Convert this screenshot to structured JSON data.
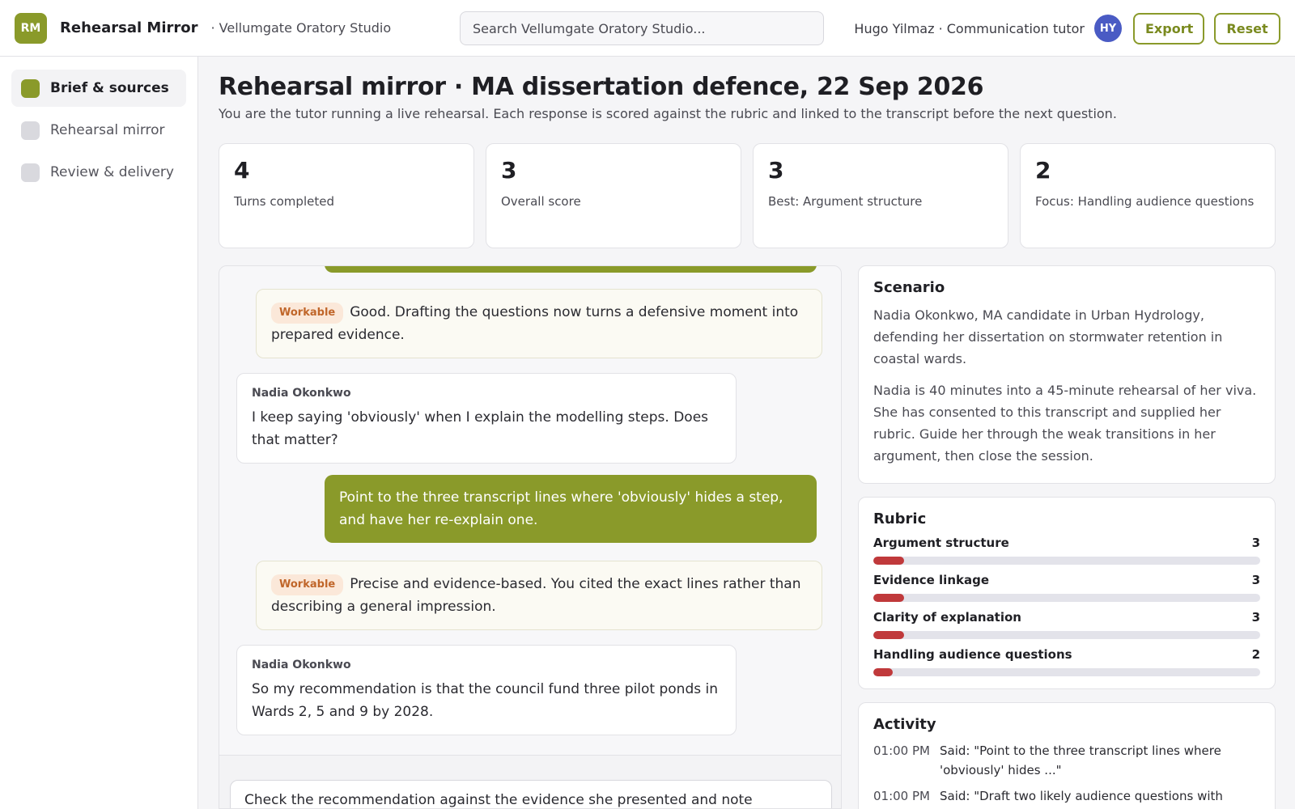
{
  "header": {
    "logo_text": "RM",
    "app_name": "Rehearsal Mirror",
    "org_name": "· Vellumgate Oratory Studio",
    "search_placeholder": "Search Vellumgate Oratory Studio...",
    "user_label": "Hugo Yilmaz · Communication tutor",
    "avatar_initials": "HY",
    "export_label": "Export",
    "reset_label": "Reset"
  },
  "sidebar": {
    "items": [
      {
        "label": "Brief & sources",
        "active": true
      },
      {
        "label": "Rehearsal mirror",
        "active": false
      },
      {
        "label": "Review & delivery",
        "active": false
      }
    ]
  },
  "page": {
    "title": "Rehearsal mirror · MA dissertation defence, 22 Sep 2026",
    "subtitle": "You are the tutor running a live rehearsal. Each response is scored against the rubric and linked to the transcript before the next question."
  },
  "stats": [
    {
      "value": "4",
      "label": "Turns completed"
    },
    {
      "value": "3",
      "label": "Overall score"
    },
    {
      "value": "3",
      "label": "Best: Argument structure"
    },
    {
      "value": "2",
      "label": "Focus: Handling audience questions"
    }
  ],
  "chat": {
    "messages": [
      {
        "badge": "Workable",
        "text": "Good. Drafting the questions now turns a defensive moment into prepared evidence."
      },
      {
        "speaker": "Nadia Okonkwo",
        "text": "I keep saying 'obviously' when I explain the modelling steps. Does that matter?"
      },
      {
        "text": "Point to the three transcript lines where 'obviously' hides a step, and have her re-explain one."
      },
      {
        "badge": "Workable",
        "text": "Precise and evidence-based. You cited the exact lines rather than describing a general impression."
      },
      {
        "speaker": "Nadia Okonkwo",
        "text": "So my recommendation is that the council fund three pilot ponds in Wards 2, 5 and 9 by 2028."
      }
    ],
    "composer_value": "Check the recommendation against the evidence she presented and note"
  },
  "scenario": {
    "title": "Scenario",
    "p1": "Nadia Okonkwo, MA candidate in Urban Hydrology, defending her dissertation on stormwater retention in coastal wards.",
    "p2": "Nadia is 40 minutes into a 45-minute rehearsal of her viva. She has consented to this transcript and supplied her rubric. Guide her through the weak transitions in her argument, then close the session."
  },
  "rubric": {
    "title": "Rubric",
    "max_score": 5,
    "items": [
      {
        "label": "Argument structure",
        "score": "3",
        "fill_pct": 8
      },
      {
        "label": "Evidence linkage",
        "score": "3",
        "fill_pct": 8
      },
      {
        "label": "Clarity of explanation",
        "score": "3",
        "fill_pct": 8
      },
      {
        "label": "Handling audience questions",
        "score": "2",
        "fill_pct": 5
      }
    ],
    "fill_color": "#c0393b"
  },
  "activity": {
    "title": "Activity",
    "items": [
      {
        "time": "01:00 PM",
        "text": "Said: \"Point to the three transcript lines where 'obviously' hides ...\""
      },
      {
        "time": "01:00 PM",
        "text": "Said: \"Draft two likely audience questions with"
      }
    ]
  },
  "colors": {
    "accent": "#8a9a2a",
    "badge_bg": "#fbe8d9",
    "badge_text": "#c0662a",
    "avatar": "#4a5bc4"
  }
}
